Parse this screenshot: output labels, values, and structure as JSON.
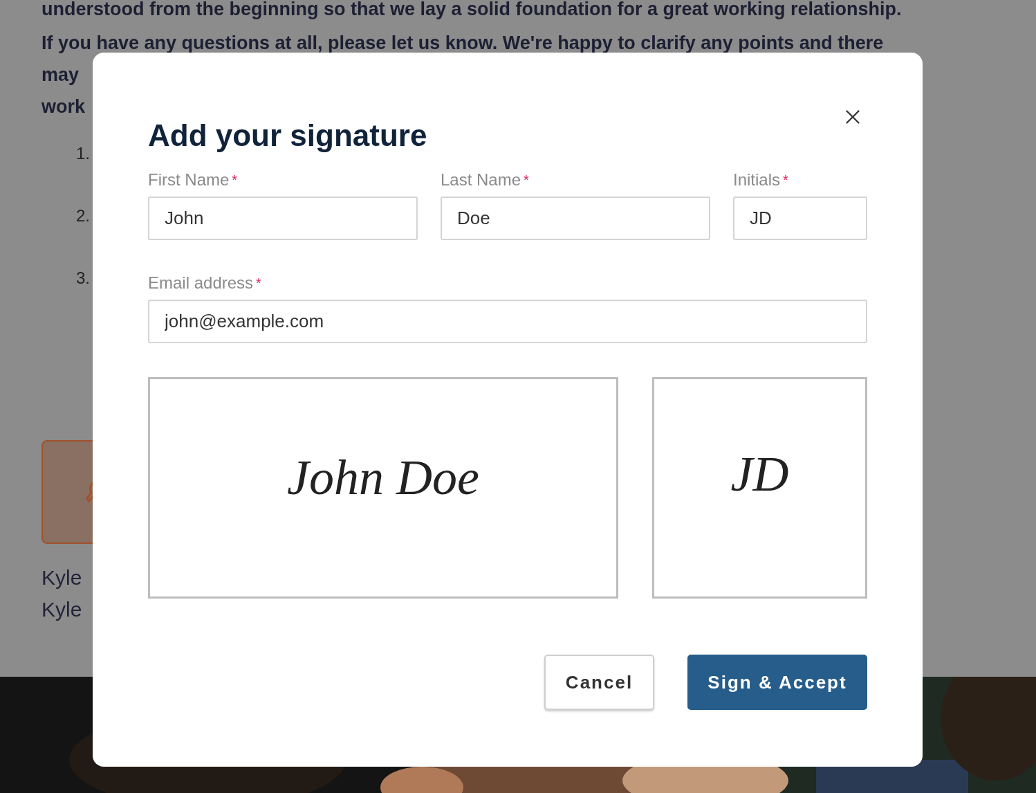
{
  "background": {
    "paragraph_lines": [
      "understood from the beginning so that we lay a solid foundation for a great working relationship.",
      "If you have any questions at all, please let us know. We're happy to clarify any points and there",
      "may",
      "work"
    ],
    "list_numbers": [
      "1.",
      "2.",
      "3."
    ],
    "names": [
      "Kyle",
      "Kyle"
    ],
    "photo": {
      "kind": "picture"
    }
  },
  "dialog": {
    "title": "Add your signature",
    "name_fields": [
      {
        "label": "First Name",
        "required_mark": "*",
        "value": "John"
      },
      {
        "label": "Last Name",
        "required_mark": "*",
        "value": "Doe"
      },
      {
        "label": "Initials",
        "required_mark": "*",
        "value": "JD"
      }
    ],
    "email_field": {
      "label": "Email address",
      "required_mark": "*",
      "value": "john@example.com"
    },
    "signature_preview": "John Doe",
    "initials_preview": "JD",
    "buttons": [
      {
        "label": "Cancel",
        "kind": "secondary"
      },
      {
        "label": "Sign & Accept",
        "kind": "primary"
      }
    ]
  }
}
